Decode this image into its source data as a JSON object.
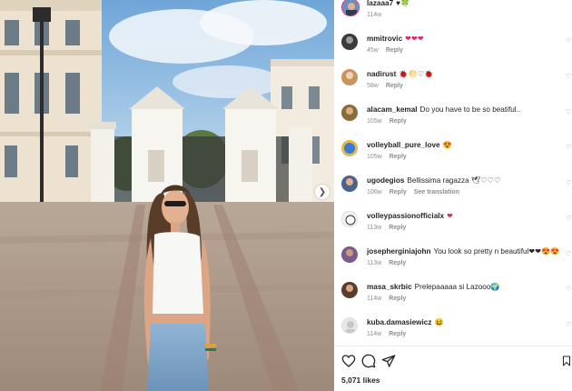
{
  "post": {
    "author": {
      "username": "lazaaa7",
      "caption": "♥🍀",
      "time": "114w"
    },
    "likes_label": "5,071 likes"
  },
  "labels": {
    "reply": "Reply",
    "see_translation": "See translation"
  },
  "comments": [
    {
      "username": "mmitrovic",
      "text": "❤❤❤",
      "time": "45w",
      "avatar_color": "#3a3a3a"
    },
    {
      "username": "nadirust",
      "text": "🐞🌕♡🐞",
      "time": "58w",
      "avatar_color": "#c8955f"
    },
    {
      "username": "alacam_kemal",
      "text": "Do you have to be so beatiful..",
      "time": "105w",
      "avatar_color": "#8a6b3c"
    },
    {
      "username": "volleyball_pure_love",
      "text": "😍",
      "time": "105w",
      "avatar_color": "#e3b84f"
    },
    {
      "username": "ugodegios",
      "text": "Bellissima ragazza 🕊♡♡♡",
      "time": "106w",
      "avatar_color": "#4c6390",
      "has_translation": true
    },
    {
      "username": "volleypassionofficialx",
      "text": "❤",
      "time": "113w",
      "avatar_color": "#f2f2f2"
    },
    {
      "username": "josepherginiajohn",
      "text": "You look so pretty n beautiful❤❤😍😍",
      "time": "113w",
      "avatar_color": "#7c5a8c"
    },
    {
      "username": "masa_skrbic",
      "text": "Prelepaaaaa si Lazooo🌍",
      "time": "114w",
      "avatar_color": "#5a3d2b"
    },
    {
      "username": "kuba.damasiewicz",
      "text": "😆",
      "time": "114w",
      "avatar_color": "#e8e8e8"
    }
  ],
  "icons": {
    "like": "heart-outline-icon",
    "comment": "speech-bubble-icon",
    "share": "paper-plane-icon",
    "save": "bookmark-icon",
    "next": "chevron-right-icon"
  }
}
